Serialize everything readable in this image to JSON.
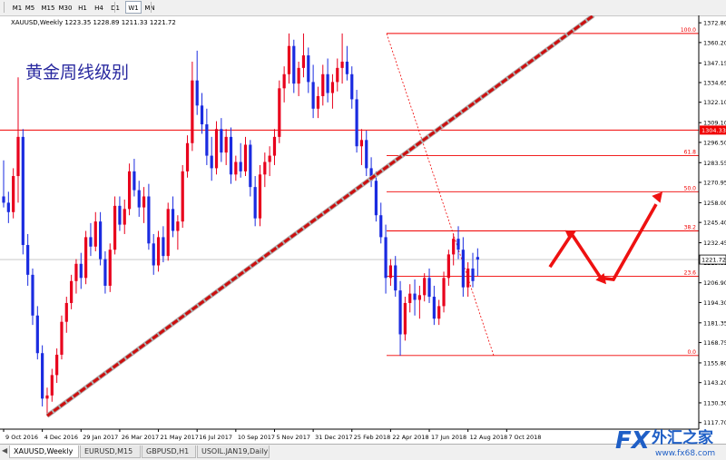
{
  "toolbar": {
    "timeframes": [
      "M1",
      "M5",
      "M15",
      "M30",
      "H1",
      "H4",
      "D1",
      "W1",
      "MN"
    ],
    "active": "W1"
  },
  "chart": {
    "header": "XAUUSD,Weekly  1223.35 1228.89 1211.33 1221.72",
    "annotation_title": "黄金周线级别",
    "current_price": "1221.72",
    "fib_label_price": "1304.33",
    "colors": {
      "bull": "#e8001c",
      "bear": "#1a2be0",
      "fib": "#f00000",
      "trend": "#cc1010",
      "arrow": "#ee1111",
      "grid": "#e6e6e6"
    }
  },
  "fib_levels": [
    {
      "label": "100.0",
      "price": 1366.0
    },
    {
      "label": "61.8",
      "price": 1288.0
    },
    {
      "label": "50.0",
      "price": 1265.0
    },
    {
      "label": "38.2",
      "price": 1240.0
    },
    {
      "label": "23.6",
      "price": 1211.0
    },
    {
      "label": "0.0",
      "price": 1160.5
    }
  ],
  "chart_data": {
    "type": "candlestick",
    "symbol": "XAUUSD",
    "timeframe": "Weekly",
    "ylim": [
      1113.5,
      1377.5
    ],
    "price_ticks": [
      "1372.80",
      "1360.20",
      "1347.15",
      "1334.65",
      "1322.10",
      "1309.10",
      "1296.50",
      "1283.55",
      "1270.95",
      "1258.00",
      "1245.40",
      "1232.45",
      "1219.85",
      "1206.90",
      "1194.30",
      "1181.35",
      "1168.75",
      "1155.80",
      "1143.20",
      "1130.30",
      "1117.70"
    ],
    "date_ticks": [
      "9 Oct 2016",
      "4 Dec 2016",
      "29 Jan 2017",
      "26 Mar 2017",
      "21 May 2017",
      "16 Jul 2017",
      "10 Sep 2017",
      "5 Nov 2017",
      "31 Dec 2017",
      "25 Feb 2018",
      "22 Apr 2018",
      "17 Jun 2018",
      "12 Aug 2018",
      "7 Oct 2018"
    ],
    "date_tick_index": [
      0,
      8,
      16,
      24,
      32,
      40,
      48,
      56,
      64,
      72,
      80,
      88,
      96,
      104
    ],
    "candles": [
      [
        1262.0,
        1285.0,
        1255.0,
        1258.0
      ],
      [
        1258.0,
        1265.0,
        1245.0,
        1252.0
      ],
      [
        1252.0,
        1280.0,
        1248.0,
        1275.0
      ],
      [
        1275.0,
        1338.0,
        1258.0,
        1300.0
      ],
      [
        1300.0,
        1305.0,
        1225.0,
        1231.0
      ],
      [
        1231.0,
        1238.0,
        1205.0,
        1212.0
      ],
      [
        1212.0,
        1216.0,
        1180.0,
        1186.0
      ],
      [
        1186.0,
        1192.0,
        1158.0,
        1162.0
      ],
      [
        1162.0,
        1167.0,
        1128.0,
        1133.0
      ],
      [
        1133.0,
        1140.0,
        1122.0,
        1135.0
      ],
      [
        1135.0,
        1152.0,
        1131.0,
        1148.0
      ],
      [
        1148.0,
        1165.0,
        1143.0,
        1161.0
      ],
      [
        1161.0,
        1186.0,
        1158.0,
        1182.0
      ],
      [
        1182.0,
        1198.0,
        1175.0,
        1194.0
      ],
      [
        1194.0,
        1212.0,
        1190.0,
        1208.0
      ],
      [
        1208.0,
        1222.0,
        1200.0,
        1219.0
      ],
      [
        1219.0,
        1226.0,
        1203.0,
        1210.0
      ],
      [
        1210.0,
        1240.0,
        1206.0,
        1236.0
      ],
      [
        1236.0,
        1245.0,
        1224.0,
        1230.0
      ],
      [
        1230.0,
        1252.0,
        1227.0,
        1246.0
      ],
      [
        1246.0,
        1252.0,
        1218.0,
        1222.0
      ],
      [
        1222.0,
        1227.0,
        1200.0,
        1205.0
      ],
      [
        1205.0,
        1232.0,
        1201.0,
        1228.0
      ],
      [
        1228.0,
        1262.0,
        1225.0,
        1256.0
      ],
      [
        1256.0,
        1262.0,
        1240.0,
        1244.0
      ],
      [
        1244.0,
        1260.0,
        1238.0,
        1254.0
      ],
      [
        1254.0,
        1283.0,
        1250.0,
        1278.0
      ],
      [
        1278.0,
        1286.0,
        1262.0,
        1266.0
      ],
      [
        1266.0,
        1272.0,
        1249.0,
        1255.0
      ],
      [
        1255.0,
        1268.0,
        1245.0,
        1262.0
      ],
      [
        1262.0,
        1270.0,
        1228.0,
        1232.0
      ],
      [
        1232.0,
        1238.0,
        1212.0,
        1218.0
      ],
      [
        1218.0,
        1240.0,
        1214.0,
        1236.0
      ],
      [
        1236.0,
        1243.0,
        1220.0,
        1224.0
      ],
      [
        1224.0,
        1258.0,
        1221.0,
        1254.0
      ],
      [
        1254.0,
        1262.0,
        1236.0,
        1240.0
      ],
      [
        1240.0,
        1250.0,
        1228.0,
        1246.0
      ],
      [
        1246.0,
        1282.0,
        1242.0,
        1278.0
      ],
      [
        1278.0,
        1301.0,
        1274.0,
        1296.0
      ],
      [
        1296.0,
        1348.0,
        1291.0,
        1336.0
      ],
      [
        1336.0,
        1355.0,
        1314.0,
        1320.0
      ],
      [
        1320.0,
        1328.0,
        1302.0,
        1308.0
      ],
      [
        1308.0,
        1318.0,
        1282.0,
        1288.0
      ],
      [
        1288.0,
        1300.0,
        1272.0,
        1280.0
      ],
      [
        1280.0,
        1310.0,
        1276.0,
        1305.0
      ],
      [
        1305.0,
        1312.0,
        1284.0,
        1290.0
      ],
      [
        1290.0,
        1305.0,
        1282.0,
        1300.0
      ],
      [
        1300.0,
        1306.0,
        1270.0,
        1276.0
      ],
      [
        1276.0,
        1288.0,
        1272.0,
        1284.0
      ],
      [
        1284.0,
        1296.0,
        1274.0,
        1278.0
      ],
      [
        1278.0,
        1300.0,
        1275.0,
        1295.0
      ],
      [
        1295.0,
        1298.0,
        1262.0,
        1268.0
      ],
      [
        1268.0,
        1275.0,
        1243.0,
        1248.0
      ],
      [
        1248.0,
        1282.0,
        1243.0,
        1276.0
      ],
      [
        1276.0,
        1290.0,
        1268.0,
        1284.0
      ],
      [
        1284.0,
        1294.0,
        1275.0,
        1288.0
      ],
      [
        1288.0,
        1305.0,
        1282.0,
        1300.0
      ],
      [
        1300.0,
        1336.0,
        1296.0,
        1331.0
      ],
      [
        1331.0,
        1345.0,
        1322.0,
        1340.0
      ],
      [
        1340.0,
        1366.0,
        1334.0,
        1358.0
      ],
      [
        1358.0,
        1362.0,
        1328.0,
        1334.0
      ],
      [
        1334.0,
        1348.0,
        1326.0,
        1344.0
      ],
      [
        1344.0,
        1366.0,
        1338.0,
        1352.0
      ],
      [
        1352.0,
        1357.0,
        1328.0,
        1335.0
      ],
      [
        1335.0,
        1346.0,
        1312.0,
        1318.0
      ],
      [
        1318.0,
        1332.0,
        1312.0,
        1326.0
      ],
      [
        1326.0,
        1346.0,
        1320.0,
        1340.0
      ],
      [
        1340.0,
        1350.0,
        1322.0,
        1328.0
      ],
      [
        1328.0,
        1340.0,
        1318.0,
        1335.0
      ],
      [
        1335.0,
        1350.0,
        1329.0,
        1344.0
      ],
      [
        1344.0,
        1366.0,
        1334.0,
        1348.0
      ],
      [
        1348.0,
        1358.0,
        1336.0,
        1340.0
      ],
      [
        1340.0,
        1345.0,
        1318.0,
        1324.0
      ],
      [
        1324.0,
        1330.0,
        1290.0,
        1294.0
      ],
      [
        1294.0,
        1305.0,
        1282.0,
        1298.0
      ],
      [
        1298.0,
        1304.0,
        1275.0,
        1280.0
      ],
      [
        1280.0,
        1287.0,
        1268.0,
        1272.0
      ],
      [
        1272.0,
        1278.0,
        1246.0,
        1250.0
      ],
      [
        1250.0,
        1258.0,
        1232.0,
        1236.0
      ],
      [
        1236.0,
        1244.0,
        1200.0,
        1210.0
      ],
      [
        1210.0,
        1222.0,
        1205.0,
        1218.0
      ],
      [
        1218.0,
        1224.0,
        1198.0,
        1202.0
      ],
      [
        1202.0,
        1208.0,
        1160.5,
        1174.0
      ],
      [
        1174.0,
        1198.0,
        1170.0,
        1194.0
      ],
      [
        1194.0,
        1206.0,
        1188.0,
        1200.0
      ],
      [
        1200.0,
        1209.0,
        1186.0,
        1196.0
      ],
      [
        1196.0,
        1205.0,
        1184.0,
        1199.0
      ],
      [
        1199.0,
        1213.0,
        1195.0,
        1210.0
      ],
      [
        1210.0,
        1216.0,
        1194.0,
        1198.0
      ],
      [
        1198.0,
        1205.0,
        1180.0,
        1184.0
      ],
      [
        1184.0,
        1196.0,
        1180.0,
        1192.0
      ],
      [
        1192.0,
        1214.0,
        1188.0,
        1210.0
      ],
      [
        1210.0,
        1228.0,
        1205.0,
        1225.0
      ],
      [
        1225.0,
        1238.0,
        1218.0,
        1235.0
      ],
      [
        1235.0,
        1243.0,
        1222.0,
        1228.0
      ],
      [
        1228.0,
        1236.0,
        1198.0,
        1204.0
      ],
      [
        1204.0,
        1220.0,
        1198.0,
        1216.0
      ],
      [
        1216.0,
        1226.0,
        1204.0,
        1208.0
      ],
      [
        1223.35,
        1228.89,
        1211.33,
        1221.72
      ]
    ]
  }
}
